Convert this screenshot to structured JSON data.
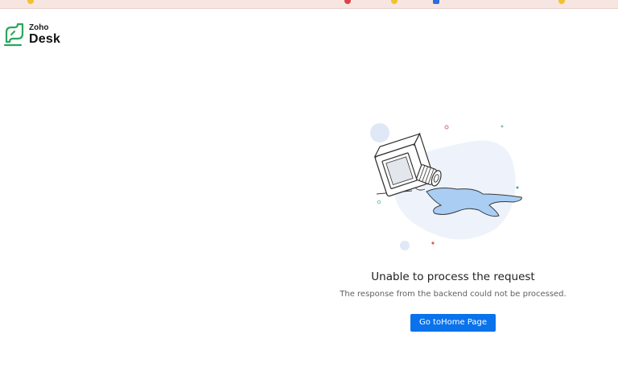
{
  "brand": {
    "top_line": "Zoho",
    "product": "Desk",
    "accent_color": "#2aa65c"
  },
  "error": {
    "title": "Unable to process the request",
    "description": "The response from the backend could not be processed.",
    "button_label": "Go toHome Page",
    "button_color": "#0a73eb"
  },
  "illustration": {
    "icon": "spilled-ink-bottle-icon"
  },
  "browser_strip": {
    "icons": [
      "yellow-dot-icon",
      "red-dot-icon",
      "yellow-dot-icon",
      "blue-square-icon"
    ]
  }
}
